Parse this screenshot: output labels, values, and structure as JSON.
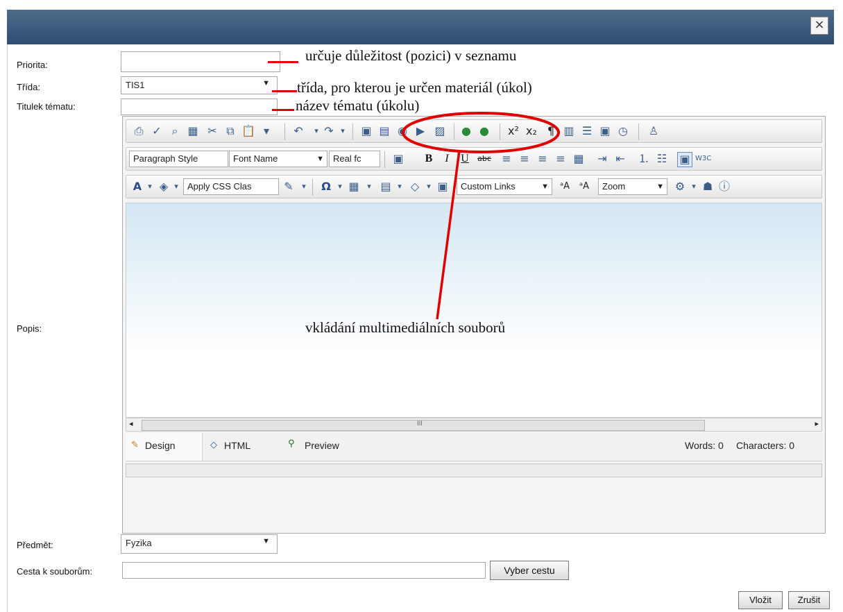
{
  "dialog": {
    "close_label": "×"
  },
  "form": {
    "priority_label": "Priorita:",
    "priority_value": "",
    "class_label": "Třída:",
    "class_value": "TIS1",
    "topic_label": "Titulek tématu:",
    "topic_value": "",
    "description_label": "Popis:",
    "subject_label": "Předmět:",
    "subject_value": "Fyzika",
    "path_label": "Cesta k souborům:",
    "path_value": "",
    "browse_button": "Vyber cestu"
  },
  "annotations": {
    "priority_note": "určuje důležitost (pozici) v seznamu",
    "class_note": "třída, pro kterou je určen materiál (úkol)",
    "topic_note": "název tématu (úkolu)",
    "multimedia_note": "vkládání multimediálních souborů"
  },
  "editor": {
    "paragraph_style": "Paragraph Style",
    "font_name": "Font Name",
    "font_size": "Real fc",
    "apply_css": "Apply CSS Clas",
    "custom_links": "Custom Links",
    "zoom": "Zoom",
    "modes": {
      "design": "Design",
      "html": "HTML",
      "preview": "Preview"
    },
    "word_count": "Words: 0",
    "char_count": "Characters: 0",
    "scroll_mark": "III"
  },
  "footer": {
    "insert_button": "Vložit",
    "cancel_button": "Zrušit"
  },
  "colors": {
    "titlebar": "#3a5878",
    "annotation": "#e10000"
  }
}
